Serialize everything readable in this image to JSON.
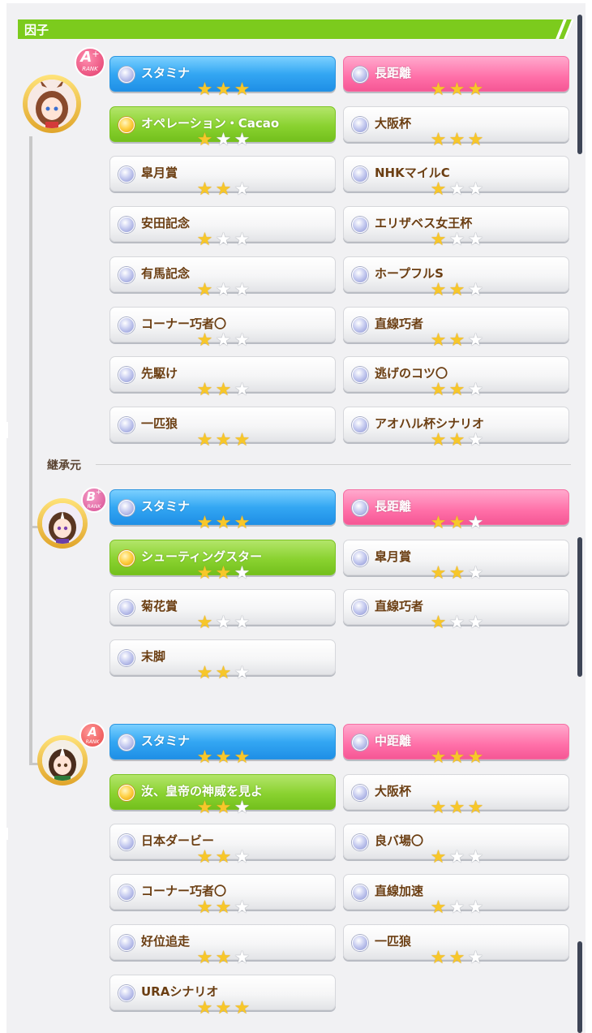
{
  "header": {
    "title": "因子"
  },
  "divider": {
    "label": "継承元"
  },
  "ranks": {
    "main": {
      "letter": "A",
      "plus": "+",
      "word": "RANK"
    },
    "parent1": {
      "letter": "B",
      "plus": "+",
      "word": "RANK"
    },
    "parent2": {
      "letter": "A",
      "plus": "",
      "word": "RANK"
    }
  },
  "groups": [
    {
      "name": "main",
      "cards": [
        {
          "label": "スタミナ",
          "stars": 3,
          "kind": "blue"
        },
        {
          "label": "長距離",
          "stars": 3,
          "kind": "pink"
        },
        {
          "label": "オペレーション・Cacao",
          "stars": 1,
          "kind": "green"
        },
        {
          "label": "大阪杯",
          "stars": 3,
          "kind": "gray"
        },
        {
          "label": "皐月賞",
          "stars": 2,
          "kind": "gray"
        },
        {
          "label": "NHKマイルC",
          "stars": 1,
          "kind": "gray"
        },
        {
          "label": "安田記念",
          "stars": 1,
          "kind": "gray"
        },
        {
          "label": "エリザベス女王杯",
          "stars": 1,
          "kind": "gray"
        },
        {
          "label": "有馬記念",
          "stars": 1,
          "kind": "gray"
        },
        {
          "label": "ホープフルS",
          "stars": 2,
          "kind": "gray"
        },
        {
          "label": "コーナー巧者〇",
          "stars": 1,
          "kind": "gray"
        },
        {
          "label": "直線巧者",
          "stars": 2,
          "kind": "gray"
        },
        {
          "label": "先駆け",
          "stars": 2,
          "kind": "gray"
        },
        {
          "label": "逃げのコツ〇",
          "stars": 2,
          "kind": "gray"
        },
        {
          "label": "一匹狼",
          "stars": 3,
          "kind": "gray"
        },
        {
          "label": "アオハル杯シナリオ",
          "stars": 2,
          "kind": "gray"
        }
      ]
    },
    {
      "name": "parent1",
      "cards": [
        {
          "label": "スタミナ",
          "stars": 3,
          "kind": "blue"
        },
        {
          "label": "長距離",
          "stars": 2,
          "kind": "pink"
        },
        {
          "label": "シューティングスター",
          "stars": 2,
          "kind": "green"
        },
        {
          "label": "皐月賞",
          "stars": 2,
          "kind": "gray"
        },
        {
          "label": "菊花賞",
          "stars": 1,
          "kind": "gray"
        },
        {
          "label": "直線巧者",
          "stars": 1,
          "kind": "gray"
        },
        {
          "label": "末脚",
          "stars": 2,
          "kind": "gray"
        }
      ]
    },
    {
      "name": "parent2",
      "cards": [
        {
          "label": "スタミナ",
          "stars": 3,
          "kind": "blue"
        },
        {
          "label": "中距離",
          "stars": 3,
          "kind": "pink"
        },
        {
          "label": "汝、皇帝の神威を見よ",
          "stars": 2,
          "kind": "green"
        },
        {
          "label": "大阪杯",
          "stars": 3,
          "kind": "gray"
        },
        {
          "label": "日本ダービー",
          "stars": 2,
          "kind": "gray"
        },
        {
          "label": "良バ場〇",
          "stars": 1,
          "kind": "gray"
        },
        {
          "label": "コーナー巧者〇",
          "stars": 2,
          "kind": "gray"
        },
        {
          "label": "直線加速",
          "stars": 1,
          "kind": "gray"
        },
        {
          "label": "好位追走",
          "stars": 2,
          "kind": "gray"
        },
        {
          "label": "一匹狼",
          "stars": 2,
          "kind": "gray"
        },
        {
          "label": "URAシナリオ",
          "stars": 3,
          "kind": "gray"
        }
      ]
    }
  ],
  "icons": {
    "star": "star-icon",
    "gem": "gem-icon",
    "avatar": "character-portrait"
  }
}
